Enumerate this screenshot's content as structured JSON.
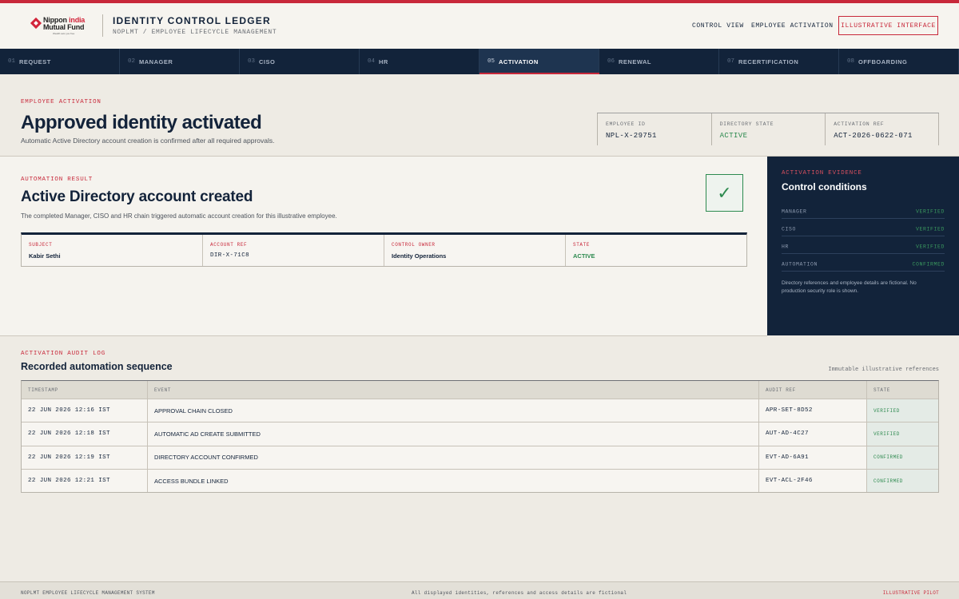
{
  "brand": {
    "line1_a": "Nippon ",
    "line1_b": "india",
    "line2": "Mutual Fund",
    "tagline": "Wealth sets you free"
  },
  "app": {
    "title": "IDENTITY CONTROL LEDGER",
    "subtitle": "NOPLMT / EMPLOYEE LIFECYCLE MANAGEMENT"
  },
  "nav": {
    "control_view": "CONTROL VIEW",
    "employee_activation": "EMPLOYEE ACTIVATION",
    "illustrative_button": "ILLUSTRATIVE INTERFACE"
  },
  "steps": [
    {
      "num": "01",
      "label": "REQUEST"
    },
    {
      "num": "02",
      "label": "MANAGER"
    },
    {
      "num": "03",
      "label": "CISO"
    },
    {
      "num": "04",
      "label": "HR"
    },
    {
      "num": "05",
      "label": "ACTIVATION"
    },
    {
      "num": "06",
      "label": "RENEWAL"
    },
    {
      "num": "07",
      "label": "RECERTIFICATION"
    },
    {
      "num": "08",
      "label": "OFFBOARDING"
    }
  ],
  "hero": {
    "eyebrow": "EMPLOYEE ACTIVATION",
    "title": "Approved identity activated",
    "subtitle": "Automatic Active Directory account creation is confirmed after all required approvals.",
    "metrics": [
      {
        "label": "EMPLOYEE ID",
        "value": "NPL-X-29751"
      },
      {
        "label": "DIRECTORY STATE",
        "value": "ACTIVE"
      },
      {
        "label": "ACTIVATION REF",
        "value": "ACT-2026-0622-071"
      }
    ]
  },
  "result": {
    "eyebrow": "AUTOMATION RESULT",
    "title": "Active Directory account created",
    "description": "The completed Manager, CISO and HR chain triggered automatic account creation for this illustrative employee.",
    "check_glyph": "✓",
    "details": [
      {
        "label": "SUBJECT",
        "value": "Kabir Sethi"
      },
      {
        "label": "ACCOUNT REF",
        "value": "DIR-X-71C8"
      },
      {
        "label": "CONTROL OWNER",
        "value": "Identity Operations"
      },
      {
        "label": "STATE",
        "value": "ACTIVE"
      }
    ]
  },
  "evidence": {
    "eyebrow": "ACTIVATION EVIDENCE",
    "title": "Control conditions",
    "rows": [
      {
        "label": "MANAGER",
        "status": "VERIFIED"
      },
      {
        "label": "CISO",
        "status": "VERIFIED"
      },
      {
        "label": "HR",
        "status": "VERIFIED"
      },
      {
        "label": "AUTOMATION",
        "status": "CONFIRMED"
      }
    ],
    "note": "Directory references and employee details are fictional. No production security role is shown."
  },
  "log": {
    "eyebrow": "ACTIVATION AUDIT LOG",
    "title": "Recorded automation sequence",
    "note": "Immutable illustrative references",
    "columns": [
      "TIMESTAMP",
      "EVENT",
      "AUDIT REF",
      "STATE"
    ],
    "rows": [
      {
        "timestamp": "22 JUN 2026 12:16 IST",
        "event": "APPROVAL CHAIN CLOSED",
        "ref": "APR-SET-8D52",
        "state": "VERIFIED"
      },
      {
        "timestamp": "22 JUN 2026 12:18 IST",
        "event": "AUTOMATIC AD CREATE SUBMITTED",
        "ref": "AUT-AD-4C27",
        "state": "VERIFIED"
      },
      {
        "timestamp": "22 JUN 2026 12:19 IST",
        "event": "DIRECTORY ACCOUNT CONFIRMED",
        "ref": "EVT-AD-6A91",
        "state": "CONFIRMED"
      },
      {
        "timestamp": "22 JUN 2026 12:21 IST",
        "event": "ACCESS BUNDLE LINKED",
        "ref": "EVT-ACL-2F46",
        "state": "CONFIRMED"
      }
    ]
  },
  "footer": {
    "left": "NOPLMT EMPLOYEE LIFECYCLE MANAGEMENT SYSTEM",
    "center": "All displayed identities, references and access details are fictional",
    "right": "ILLUSTRATIVE PILOT"
  },
  "colors": {
    "accent": "#c8283a",
    "navy": "#12233a",
    "success": "#2d8a4f",
    "background": "#eeebe4"
  }
}
